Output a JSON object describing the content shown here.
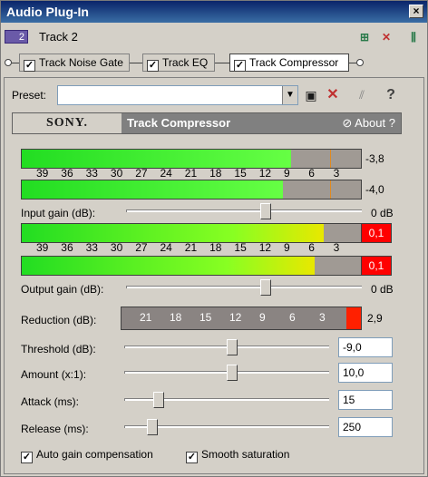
{
  "window": {
    "title": "Audio Plug-In",
    "close_label": "×"
  },
  "track": {
    "number": "2",
    "name": "Track 2"
  },
  "chain": [
    {
      "label": "Track Noise Gate",
      "checked": true
    },
    {
      "label": "Track EQ",
      "checked": true
    },
    {
      "label": "Track Compressor",
      "checked": true
    }
  ],
  "preset": {
    "label": "Preset:",
    "value": ""
  },
  "header": {
    "brand": "SONY.",
    "plugin_name": "Track Compressor",
    "about_label": "About",
    "about_q": "?"
  },
  "input_meters": {
    "scale": [
      "39",
      "36",
      "33",
      "30",
      "27",
      "24",
      "21",
      "18",
      "15",
      "12",
      "9",
      "6",
      "3"
    ],
    "left": {
      "value_label": "-3,8",
      "level_db": -3.8
    },
    "right": {
      "value_label": "-4,0",
      "level_db": -4.0
    }
  },
  "input_gain": {
    "label": "Input gain (dB):",
    "value_label": "0 dB",
    "value": 0
  },
  "output_meters": {
    "scale": [
      "39",
      "36",
      "33",
      "30",
      "27",
      "24",
      "21",
      "18",
      "15",
      "12",
      "9",
      "6",
      "3"
    ],
    "left": {
      "clip_label": "0,1",
      "level_db": -0.1
    },
    "right": {
      "clip_label": "0,1",
      "level_db": -0.1
    }
  },
  "output_gain": {
    "label": "Output gain (dB):",
    "value_label": "0 dB",
    "value": 0
  },
  "reduction": {
    "label": "Reduction (dB):",
    "scale": [
      "21",
      "18",
      "15",
      "12",
      "9",
      "6",
      "3"
    ],
    "value_label": "2,9",
    "value": 2.9
  },
  "controls": [
    {
      "key": "threshold",
      "label": "Threshold (dB):",
      "value": "-9,0",
      "fraction": 0.5
    },
    {
      "key": "amount",
      "label": "Amount (x:1):",
      "value": "10,0",
      "fraction": 0.5
    },
    {
      "key": "attack",
      "label": "Attack (ms):",
      "value": "15",
      "fraction": 0.14
    },
    {
      "key": "release",
      "label": "Release (ms):",
      "value": "250",
      "fraction": 0.11
    }
  ],
  "options": {
    "auto_gain": "Auto gain compensation",
    "smooth": "Smooth saturation"
  },
  "colors": {
    "meter_green": "#33ee33",
    "meter_yellow": "#e8e800",
    "clip_red": "#ff0000",
    "title_blue": "#0a246a"
  },
  "icons": {
    "save": "save-icon",
    "delete": "delete-icon",
    "bypass": "bypass-icon",
    "help": "help-icon"
  }
}
